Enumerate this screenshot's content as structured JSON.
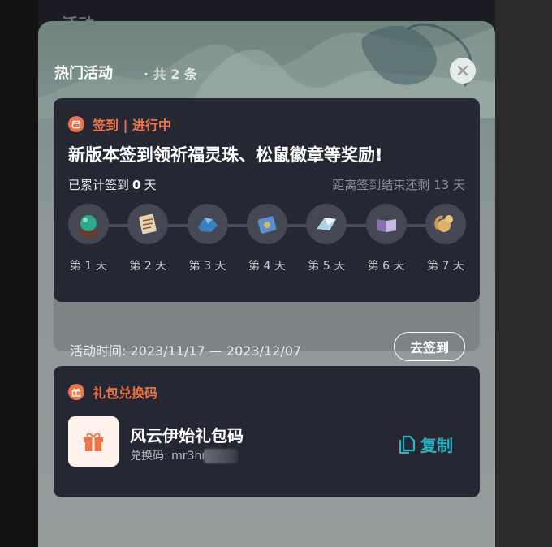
{
  "background": {
    "title": "活动"
  },
  "sheet": {
    "title": "热门活动",
    "count": "· 共 2 条",
    "close_icon": "close-icon"
  },
  "checkin": {
    "tag": "签到 | 进行中",
    "headline": "新版本签到领祈福灵珠、松鼠徽章等奖励!",
    "progress_prefix": "已累计签到",
    "progress_days": "0",
    "progress_suffix": "天",
    "remaining": "距离签到结束还剩 13 天",
    "days": [
      {
        "label": "第 1 天",
        "icon": "crystal-ball-icon"
      },
      {
        "label": "第 2 天",
        "icon": "scroll-icon"
      },
      {
        "label": "第 3 天",
        "icon": "blue-ore-icon"
      },
      {
        "label": "第 4 天",
        "icon": "blue-chest-icon"
      },
      {
        "label": "第 5 天",
        "icon": "crystal-icon"
      },
      {
        "label": "第 6 天",
        "icon": "book-icon"
      },
      {
        "label": "第 7 天",
        "icon": "squirrel-badge-icon"
      }
    ],
    "date_range": "活动时间: 2023/11/17 — 2023/12/07",
    "go_button": "去签到"
  },
  "gift": {
    "tag": "礼包兑换码",
    "name": "风云伊始礼包码",
    "code_label": "兑换码: mr3hn",
    "copy_label": "复制"
  },
  "colors": {
    "accent_orange": "#f07345",
    "accent_teal": "#29b5c5",
    "card_bg": "#252733"
  }
}
